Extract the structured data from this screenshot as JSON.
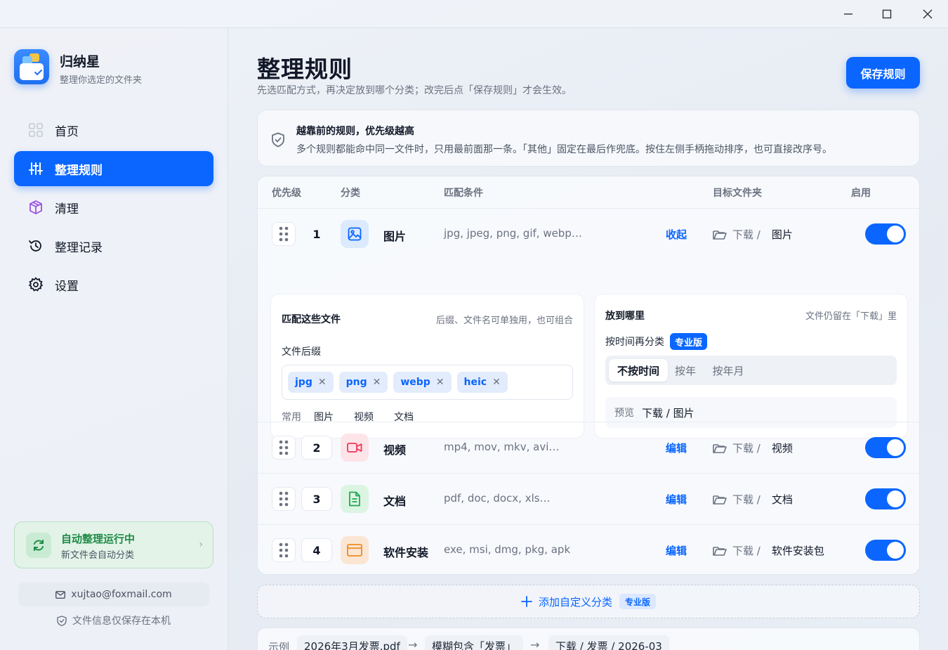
{
  "app": {
    "name": "归纳星",
    "subtitle": "整理你选定的文件夹"
  },
  "nav": [
    {
      "label": "首页",
      "icon": "grid-icon",
      "active": false
    },
    {
      "label": "整理规则",
      "icon": "sliders-icon",
      "active": true
    },
    {
      "label": "清理",
      "icon": "cube-icon",
      "active": false
    },
    {
      "label": "整理记录",
      "icon": "history-icon",
      "active": false
    },
    {
      "label": "设置",
      "icon": "gear-icon",
      "active": false
    }
  ],
  "auto": {
    "title": "自动整理运行中",
    "desc": "新文件会自动分类"
  },
  "account": {
    "email": "xujtao@foxmail.com",
    "local_note": "文件信息仅保存在本机"
  },
  "page": {
    "title": "整理规则",
    "subtitle": "先选匹配方式，再决定放到哪个分类；改完后点「保存规则」才会生效。",
    "save_label": "保存规则"
  },
  "info": {
    "title": "越靠前的规则，优先级越高",
    "desc": "多个规则都能命中同一文件时，只用最前面那一条。「其他」固定在最后作兜底。按住左侧手柄拖动排序，也可直接改序号。"
  },
  "table": {
    "headers": {
      "priority": "优先级",
      "category": "分类",
      "condition": "匹配条件",
      "target": "目标文件夹",
      "enabled": "启用"
    },
    "rows": [
      {
        "priority": "1",
        "name": "图片",
        "condition": "jpg, jpeg, png, gif, webp…",
        "action": "收起",
        "base": "下载 /",
        "dest": "图片",
        "enabled": true
      },
      {
        "priority": "2",
        "name": "视频",
        "condition": "mp4, mov, mkv, avi…",
        "action": "编辑",
        "base": "下载 /",
        "dest": "视频",
        "enabled": true
      },
      {
        "priority": "3",
        "name": "文档",
        "condition": "pdf, doc, docx, xls…",
        "action": "编辑",
        "base": "下载 /",
        "dest": "文档",
        "enabled": true
      },
      {
        "priority": "4",
        "name": "软件安装",
        "condition": "exe, msi, dmg, pkg, apk",
        "action": "编辑",
        "base": "下载 /",
        "dest": "软件安装包",
        "enabled": true
      }
    ]
  },
  "match_panel": {
    "title": "匹配这些文件",
    "hint": "后缀、文件名可单独用，也可组合",
    "ext_label": "文件后缀",
    "exts": [
      "jpg",
      "png",
      "webp",
      "heic"
    ],
    "common_label": "常用",
    "common": [
      "图片",
      "视频",
      "文档"
    ]
  },
  "dest_panel": {
    "title": "放到哪里",
    "hint": "文件仍留在「下载」里",
    "time_label": "按时间再分类",
    "pro_badge": "专业版",
    "segments": [
      "不按时间",
      "按年",
      "按年月"
    ],
    "preview_label": "预览",
    "preview_value": "下载 / 图片"
  },
  "add": {
    "label": "添加自定义分类",
    "badge": "专业版"
  },
  "example": {
    "label": "示例",
    "file": "2026年3月发票.pdf",
    "rule": "模糊包含「发票」",
    "result": "下载 / 发票 / 2026-03"
  },
  "colors": {
    "accent": "#0a66ff",
    "success": "#1e8a45"
  }
}
